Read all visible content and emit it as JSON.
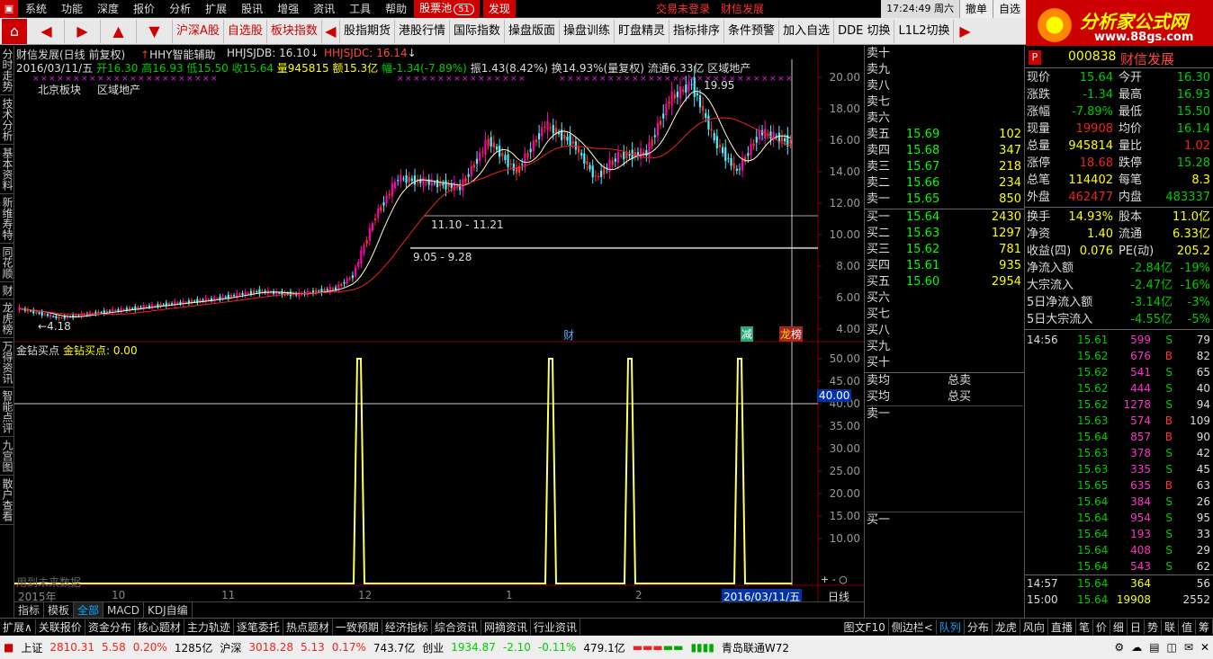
{
  "menu": {
    "items": [
      "系统",
      "功能",
      "深度",
      "报价",
      "分析",
      "扩展",
      "股讯",
      "增强",
      "资讯",
      "工具",
      "帮助"
    ],
    "stock_pool": "股票池",
    "stock_pool_count": "51",
    "discover": "发现",
    "trade_status": "交易未登录",
    "stock_name_top": "财信发展",
    "clock": "17:24:49 周六",
    "withdraw": "撤单",
    "auto": "自选"
  },
  "brand": {
    "title": "分析家公式网",
    "url": "www.88gs.com"
  },
  "toolbar": {
    "buttons": [
      "沪深A股",
      "自选股",
      "板块指数",
      "股指期货",
      "港股行情",
      "国际指数",
      "操盘版面",
      "操盘训练",
      "盯盘精灵",
      "指标排序",
      "条件预警",
      "加入自选",
      "DDE 切换",
      "L1L2切换"
    ]
  },
  "left_tabs": [
    "分时走势",
    "技术分析",
    "基本资料",
    "新维寿特",
    "同花顺",
    "财",
    "龙虎榜",
    "万得资讯",
    "智能点评",
    "九宫图",
    "散户查看"
  ],
  "chart_header": {
    "line1": "财信发展(日线 前复权)",
    "indicator1": "HHY智能辅助",
    "hhjsjdb": "HHJSJDB: 16.10",
    "hhjsjdc": "HHJSJDC: 16.14",
    "date": "2016/03/11/五",
    "open": "开16.30",
    "high": "高16.93",
    "low": "低15.50",
    "close": "收15.64",
    "vol": "量945815",
    "amount": "额15.3亿",
    "change": "幅-1.34(-7.89%)",
    "amp": "振1.43(8.42%)",
    "turn": "换14.93%(量复权)",
    "flow": "流通6.33亿",
    "sector": "区域地产",
    "region1": "北京板块",
    "region2": "区域地产"
  },
  "chart_annotations": {
    "high_label": "19.95",
    "low_label": "4.18",
    "range1": "11.10 - 11.21",
    "range2": "9.05 - 9.28",
    "tag_cai": "财",
    "tag_jian": "减",
    "tag_bang": "榜"
  },
  "sub_chart": {
    "title": "金钻买点",
    "value": "金钻买点: 0.00",
    "cursor_value": "40.00",
    "note": "用到未来数据"
  },
  "chart_data": [
    {
      "type": "line",
      "title": "金钻买点",
      "x": [
        "2015年",
        "10",
        "11",
        "12",
        "1",
        "2",
        "2016/03/11/五"
      ],
      "ylim": [
        0,
        50
      ],
      "y_ticks": [
        10.0,
        15.0,
        20.0,
        25.0,
        30.0,
        35.0,
        40.0,
        45.0,
        50.0
      ],
      "series": [
        {
          "name": "金钻买点",
          "values": [
            0,
            0,
            0,
            50,
            0,
            0,
            50,
            0,
            50,
            0,
            50,
            0,
            0
          ]
        }
      ]
    },
    {
      "type": "candlestick",
      "ylim": [
        4,
        20
      ],
      "y_ticks": [
        4.0,
        6.0,
        8.0,
        10.0,
        12.0,
        14.0,
        16.0,
        18.0,
        20.0
      ],
      "x_ticks": [
        "2015年",
        "10",
        "11",
        "12",
        "1",
        "2",
        "2016/03/11/五"
      ]
    }
  ],
  "xaxis": {
    "labels": [
      "2015年",
      "10",
      "11",
      "12",
      "1",
      "2"
    ],
    "cursor_date": "2016/03/11/五",
    "period": "日线"
  },
  "chart_tabs": [
    "指标",
    "模板",
    "全部",
    "MACD",
    "KDJ自编"
  ],
  "depth": {
    "sell": [
      {
        "label": "卖十",
        "price": "",
        "vol": ""
      },
      {
        "label": "卖九",
        "price": "",
        "vol": ""
      },
      {
        "label": "卖八",
        "price": "",
        "vol": ""
      },
      {
        "label": "卖七",
        "price": "",
        "vol": ""
      },
      {
        "label": "卖六",
        "price": "",
        "vol": ""
      },
      {
        "label": "卖五",
        "price": "15.69",
        "vol": "102"
      },
      {
        "label": "卖四",
        "price": "15.68",
        "vol": "347"
      },
      {
        "label": "卖三",
        "price": "15.67",
        "vol": "218"
      },
      {
        "label": "卖二",
        "price": "15.66",
        "vol": "234"
      },
      {
        "label": "卖一",
        "price": "15.65",
        "vol": "850"
      }
    ],
    "buy": [
      {
        "label": "买一",
        "price": "15.64",
        "vol": "2430"
      },
      {
        "label": "买二",
        "price": "15.63",
        "vol": "1297"
      },
      {
        "label": "买三",
        "price": "15.62",
        "vol": "781"
      },
      {
        "label": "买四",
        "price": "15.61",
        "vol": "935"
      },
      {
        "label": "买五",
        "price": "15.60",
        "vol": "2954"
      },
      {
        "label": "买六",
        "price": "",
        "vol": ""
      },
      {
        "label": "买七",
        "price": "",
        "vol": ""
      },
      {
        "label": "买八",
        "price": "",
        "vol": ""
      },
      {
        "label": "买九",
        "price": "",
        "vol": ""
      },
      {
        "label": "买十",
        "price": "",
        "vol": ""
      }
    ],
    "avg_sell": "卖均",
    "avg_buy": "买均",
    "total_sell": "总卖",
    "total_buy": "总买",
    "sell1_b": "卖一",
    "buy1_b": "买一"
  },
  "quote": {
    "code": "000838",
    "name": "财信发展",
    "rows": [
      {
        "l1": "现价",
        "v1": "15.64",
        "c1": "grn",
        "l2": "今开",
        "v2": "16.30",
        "c2": "grn"
      },
      {
        "l1": "涨跌",
        "v1": "-1.34",
        "c1": "grn",
        "l2": "最高",
        "v2": "16.93",
        "c2": "grn"
      },
      {
        "l1": "涨幅",
        "v1": "-7.89%",
        "c1": "grn",
        "l2": "最低",
        "v2": "15.50",
        "c2": "grn"
      },
      {
        "l1": "现量",
        "v1": "19908",
        "c1": "red",
        "l2": "均价",
        "v2": "16.14",
        "c2": "grn"
      },
      {
        "l1": "总量",
        "v1": "945814",
        "c1": "yel",
        "l2": "量比",
        "v2": "1.02",
        "c2": "red"
      },
      {
        "l1": "涨停",
        "v1": "18.68",
        "c1": "red",
        "l2": "跌停",
        "v2": "15.28",
        "c2": "grn"
      },
      {
        "l1": "总笔",
        "v1": "114402",
        "c1": "yel",
        "l2": "每笔",
        "v2": "8.3",
        "c2": "yel"
      },
      {
        "l1": "外盘",
        "v1": "462477",
        "c1": "red",
        "l2": "内盘",
        "v2": "483337",
        "c2": "grn"
      },
      {
        "l1": "换手",
        "v1": "14.93%",
        "c1": "yel",
        "l2": "股本",
        "v2": "11.0亿",
        "c2": "yel"
      },
      {
        "l1": "净资",
        "v1": "1.40",
        "c1": "yel",
        "l2": "流通",
        "v2": "6.33亿",
        "c2": "yel"
      },
      {
        "l1": "收益(四)",
        "v1": "0.076",
        "c1": "yel",
        "l2": "PE(动)",
        "v2": "205.2",
        "c2": "yel"
      }
    ],
    "flows": [
      {
        "l": "净流入额",
        "v": "-2.84亿",
        "p": "-19%"
      },
      {
        "l": "大宗流入",
        "v": "-2.47亿",
        "p": "-16%"
      },
      {
        "l": "5日净流入额",
        "v": "-3.14亿",
        "p": "-3%"
      },
      {
        "l": "5日大宗流入",
        "v": "-4.55亿",
        "p": "-5%"
      }
    ],
    "ticks": [
      {
        "t": "14:56",
        "p": "15.61",
        "v": "599",
        "s": "S",
        "n": "79"
      },
      {
        "t": "",
        "p": "15.62",
        "v": "676",
        "s": "B",
        "n": "82"
      },
      {
        "t": "",
        "p": "15.62",
        "v": "541",
        "s": "S",
        "n": "65"
      },
      {
        "t": "",
        "p": "15.62",
        "v": "444",
        "s": "S",
        "n": "40"
      },
      {
        "t": "",
        "p": "15.62",
        "v": "1278",
        "s": "S",
        "n": "94"
      },
      {
        "t": "",
        "p": "15.63",
        "v": "574",
        "s": "B",
        "n": "109"
      },
      {
        "t": "",
        "p": "15.64",
        "v": "857",
        "s": "B",
        "n": "90"
      },
      {
        "t": "",
        "p": "15.63",
        "v": "378",
        "s": "S",
        "n": "42"
      },
      {
        "t": "",
        "p": "15.63",
        "v": "335",
        "s": "S",
        "n": "45"
      },
      {
        "t": "",
        "p": "15.65",
        "v": "635",
        "s": "B",
        "n": "63"
      },
      {
        "t": "",
        "p": "15.64",
        "v": "384",
        "s": "S",
        "n": "26"
      },
      {
        "t": "",
        "p": "15.64",
        "v": "954",
        "s": "S",
        "n": "95"
      },
      {
        "t": "",
        "p": "15.64",
        "v": "193",
        "s": "S",
        "n": "33"
      },
      {
        "t": "",
        "p": "15.64",
        "v": "408",
        "s": "S",
        "n": "29"
      },
      {
        "t": "",
        "p": "15.64",
        "v": "543",
        "s": "S",
        "n": "62"
      },
      {
        "t": "14:57",
        "p": "15.64",
        "v": "364",
        "s": "",
        "n": "56"
      },
      {
        "t": "15:00",
        "p": "15.64",
        "v": "19908",
        "s": "",
        "n": "2552"
      }
    ]
  },
  "bottom_tabs": [
    "扩展∧",
    "关联报价",
    "资金分布",
    "核心题材",
    "主力轨迹",
    "逐笔委托",
    "热点题材",
    "一致预期",
    "经济指标",
    "综合资讯",
    "网摘资讯",
    "行业资讯"
  ],
  "bottom_right": [
    "图文F10",
    "侧边栏<",
    "队列",
    "分布",
    "龙虎",
    "风向",
    "直播",
    "笔",
    "价",
    "细",
    "日",
    "势",
    "联",
    "值",
    "筹"
  ],
  "statusbar": {
    "sh_label": "上证",
    "sh_val": "2810.31",
    "sh_chg": "5.58",
    "sh_pct": "0.20%",
    "sh_amt": "1285亿",
    "hs_label": "沪深",
    "hs_val": "3018.28",
    "hs_chg": "5.13",
    "hs_pct": "0.17%",
    "hs_amt": "743.7亿",
    "cy_label": "创业",
    "cy_val": "1934.87",
    "cy_chg": "-2.10",
    "cy_pct": "-0.11%",
    "cy_amt": "479.1亿",
    "broker": "青岛联通W72"
  }
}
